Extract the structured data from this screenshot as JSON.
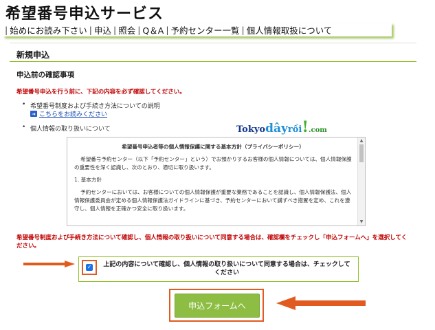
{
  "site": {
    "title": "希望番号申込サービス"
  },
  "nav": {
    "items": [
      {
        "label": "始めにお読み下さい"
      },
      {
        "label": "申込"
      },
      {
        "label": "照会"
      },
      {
        "label": "Q＆A"
      },
      {
        "label": "予約センター一覧"
      },
      {
        "label": "個人情報取扱について"
      }
    ],
    "separator": "|"
  },
  "main": {
    "section_title": "新規申込",
    "sub_title": "申込前の確認事項",
    "notice_top": "希望番号申込を行う前に、下記の内容を必ず確認してください。",
    "bullet_1": "希望番号制度および手続き方法についての説明",
    "link_text": "こちらをお読みください",
    "bullet_2": "個人情報の取り扱いについて",
    "policy": {
      "heading": "希望番号申込者等の個人情報保護に関する基本方針（プライバシーポリシー）",
      "para_1": "希望番号予約センター（以下「予約センター」という）でお預かりするお客様の個人情報については、個人情報保護の重要性を深く認識し、次のとおり、適切に取り扱います。",
      "section_1": "1. 基本方針",
      "para_2": "予約センターにおいては、お客様についての個人情報保護が重要な業務であることを認識し、個人情報保護法、個人情報保護委員会が定める個人情報保護法ガイドラインに基づき、予約センターにおいて講ずべき措置を定め、これを遵守し、個人情報を正確かつ安全に取り扱います。"
    },
    "watermark": {
      "part1": "Tokyo",
      "part2": "dây",
      "part3": "rồi",
      "part4": "!",
      "part5": ".com"
    },
    "notice_bottom": "希望番号制度および手続き方法について確認し、個人情報の取り扱いについて同意する場合は、確認欄をチェックし「申込フォームへ」を選択してください。",
    "agree_text": "上記の内容について確認し、個人情報の取り扱いについて同意する場合は、チェックしてください",
    "submit_label": "申込フォームへ"
  },
  "colors": {
    "accent_green": "#8dc021",
    "alert_red": "#c00000",
    "arrow_orange": "#e15a1f",
    "button_green": "#8dbd43"
  }
}
